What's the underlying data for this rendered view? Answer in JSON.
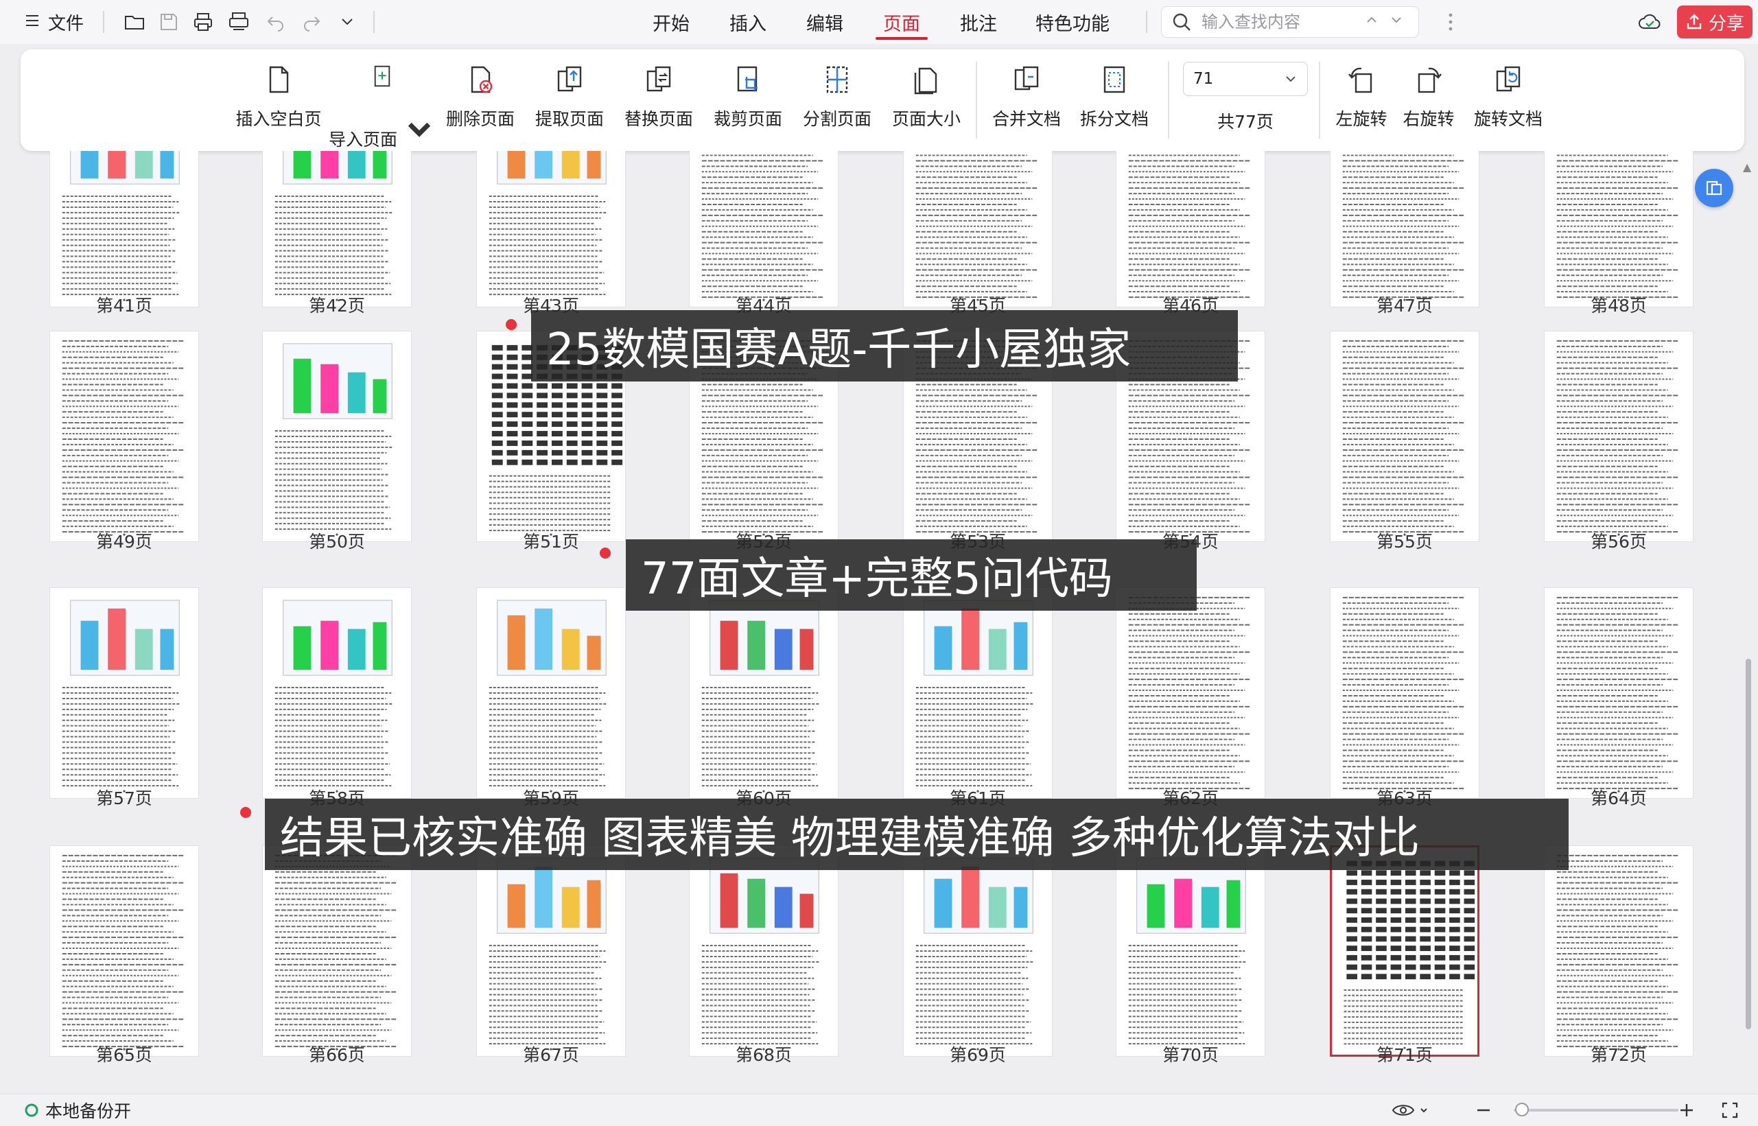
{
  "topbar": {
    "file_label": "文件",
    "tabs": [
      {
        "label": "开始",
        "active": false
      },
      {
        "label": "插入",
        "active": false
      },
      {
        "label": "编辑",
        "active": false
      },
      {
        "label": "页面",
        "active": true
      },
      {
        "label": "批注",
        "active": false
      },
      {
        "label": "特色功能",
        "active": false
      }
    ],
    "search_placeholder": "输入查找内容",
    "share_label": "分享"
  },
  "ribbon": {
    "buttons": [
      {
        "label": "插入空白页",
        "icon": "blank-page-icon"
      },
      {
        "label": "导入页面",
        "icon": "import-page-icon",
        "has_dropdown": true
      },
      {
        "label": "删除页面",
        "icon": "delete-page-icon"
      },
      {
        "label": "提取页面",
        "icon": "extract-page-icon"
      },
      {
        "label": "替换页面",
        "icon": "replace-page-icon"
      },
      {
        "label": "裁剪页面",
        "icon": "crop-page-icon"
      },
      {
        "label": "分割页面",
        "icon": "split-page-icon"
      },
      {
        "label": "页面大小",
        "icon": "page-size-icon"
      },
      {
        "label": "合并文档",
        "icon": "merge-doc-icon"
      },
      {
        "label": "拆分文档",
        "icon": "split-doc-icon"
      },
      {
        "label": "左旋转",
        "icon": "rotate-left-icon"
      },
      {
        "label": "右旋转",
        "icon": "rotate-right-icon"
      },
      {
        "label": "旋转文档",
        "icon": "rotate-doc-icon"
      }
    ],
    "current_page": "71",
    "total_pages": "共77页"
  },
  "pages": {
    "row1": [
      "第41页",
      "第42页",
      "第43页",
      "第44页",
      "第45页",
      "第46页",
      "第47页",
      "第48页"
    ],
    "row2": [
      "第49页",
      "第50页",
      "第51页",
      "第52页",
      "第53页",
      "第54页",
      "第55页",
      "第56页"
    ],
    "row3": [
      "第57页",
      "第58页",
      "第59页",
      "第60页",
      "第61页",
      "第62页",
      "第63页",
      "第64页"
    ],
    "row4": [
      "第65页",
      "第66页",
      "第67页",
      "第68页",
      "第69页",
      "第70页",
      "第71页",
      "第72页"
    ],
    "selected": "第71页"
  },
  "overlays": [
    "25数模国赛A题-千千小屋独家",
    "77面文章+完整5问代码",
    "结果已核实准确 图表精美 物理建模准确 多种优化算法对比"
  ],
  "status": {
    "backup_label": "本地备份开"
  },
  "colors": {
    "accent": "#d6222f",
    "share_bg": "#e8404c",
    "overlay_bg": "#262626",
    "selected_border": "#c8313c",
    "side_button": "#3e86ee"
  }
}
